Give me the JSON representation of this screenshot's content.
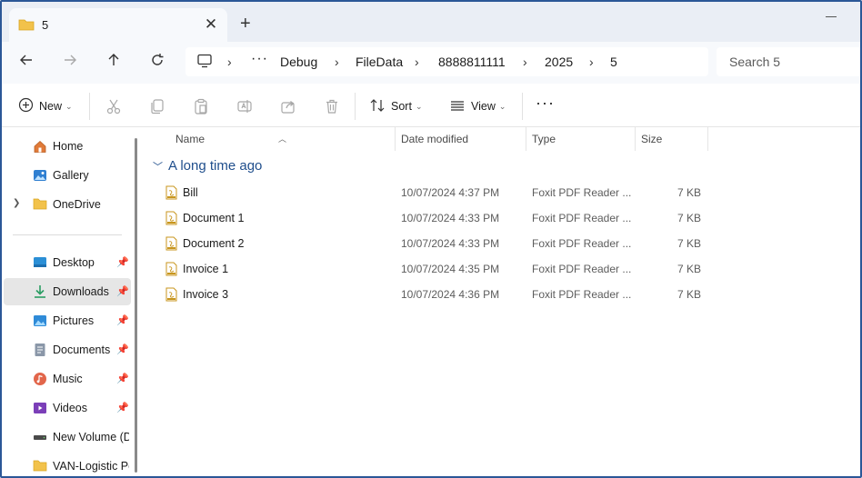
{
  "tab": {
    "title": "5",
    "close": "✕",
    "new_tab": "+"
  },
  "breadcrumb": [
    "Debug",
    "FileData",
    "8888811111",
    "2025",
    "5"
  ],
  "breadcrumb_overflow": "···",
  "search": {
    "placeholder": "Search 5"
  },
  "commands": {
    "new_label": "New",
    "sort_label": "Sort",
    "view_label": "View",
    "more": "···"
  },
  "sidebar": {
    "items": [
      {
        "label": "Home",
        "icon": "home-icon"
      },
      {
        "label": "Gallery",
        "icon": "gallery-icon"
      },
      {
        "label": "OneDrive",
        "icon": "folder-icon"
      },
      {
        "label": "Desktop",
        "icon": "desktop-icon"
      },
      {
        "label": "Downloads",
        "icon": "download-icon"
      },
      {
        "label": "Pictures",
        "icon": "pictures-icon"
      },
      {
        "label": "Documents",
        "icon": "documents-icon"
      },
      {
        "label": "Music",
        "icon": "music-icon"
      },
      {
        "label": "Videos",
        "icon": "videos-icon"
      },
      {
        "label": "New Volume (D:",
        "icon": "drive-icon"
      },
      {
        "label": "VAN-Logistic Pc",
        "icon": "folder-icon"
      }
    ]
  },
  "columns": {
    "name": "Name",
    "date": "Date modified",
    "type": "Type",
    "size": "Size"
  },
  "group": {
    "label": "A long time ago"
  },
  "files": [
    {
      "name": "Bill",
      "date": "10/07/2024 4:37 PM",
      "type": "Foxit PDF Reader ...",
      "size": "7 KB"
    },
    {
      "name": "Document 1",
      "date": "10/07/2024 4:33 PM",
      "type": "Foxit PDF Reader ...",
      "size": "7 KB"
    },
    {
      "name": "Document 2",
      "date": "10/07/2024 4:33 PM",
      "type": "Foxit PDF Reader ...",
      "size": "7 KB"
    },
    {
      "name": "Invoice 1",
      "date": "10/07/2024 4:35 PM",
      "type": "Foxit PDF Reader ...",
      "size": "7 KB"
    },
    {
      "name": "Invoice 3",
      "date": "10/07/2024 4:36 PM",
      "type": "Foxit PDF Reader ...",
      "size": "7 KB"
    }
  ],
  "colors": {
    "accent": "#1f4e8c",
    "frame": "#2b5797",
    "folder": "#f2c24b",
    "selected": "#e6e6e6"
  }
}
